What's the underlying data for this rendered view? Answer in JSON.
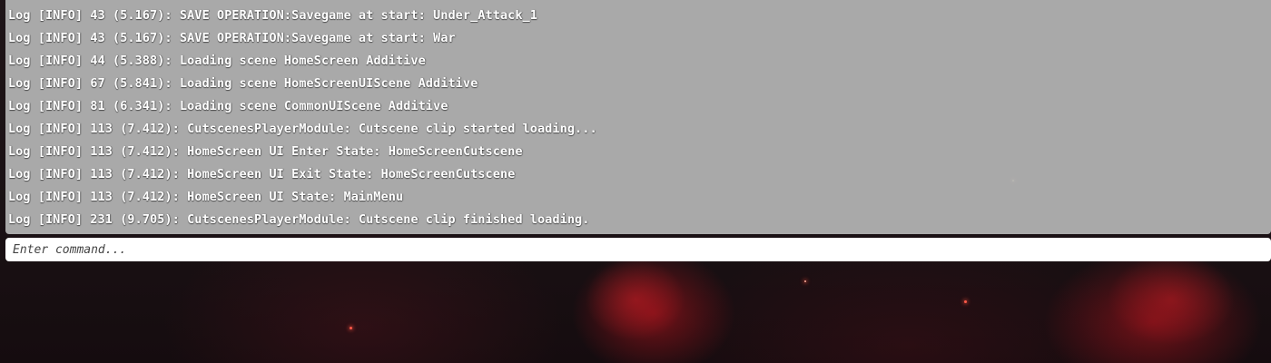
{
  "console": {
    "lines": [
      {
        "prefix": "Log",
        "level": "[INFO]",
        "frame": "43",
        "time": "(5.167):",
        "message": "SAVE OPERATION:Savegame at start: Under_Attack_1"
      },
      {
        "prefix": "Log",
        "level": "[INFO]",
        "frame": "43",
        "time": "(5.167):",
        "message": "SAVE OPERATION:Savegame at start: War"
      },
      {
        "prefix": "Log",
        "level": "[INFO]",
        "frame": "44",
        "time": "(5.388):",
        "message": "Loading scene HomeScreen Additive"
      },
      {
        "prefix": "Log",
        "level": "[INFO]",
        "frame": "67",
        "time": "(5.841):",
        "message": "Loading scene HomeScreenUIScene Additive"
      },
      {
        "prefix": "Log",
        "level": "[INFO]",
        "frame": "81",
        "time": "(6.341):",
        "message": "Loading scene CommonUIScene Additive"
      },
      {
        "prefix": "Log",
        "level": "[INFO]",
        "frame": "113",
        "time": "(7.412):",
        "message": "CutscenesPlayerModule: Cutscene clip started loading..."
      },
      {
        "prefix": "Log",
        "level": "[INFO]",
        "frame": "113",
        "time": "(7.412):",
        "message": "HomeScreen UI Enter State: HomeScreenCutscene"
      },
      {
        "prefix": "Log",
        "level": "[INFO]",
        "frame": "113",
        "time": "(7.412):",
        "message": "HomeScreen UI Exit State: HomeScreenCutscene"
      },
      {
        "prefix": "Log",
        "level": "[INFO]",
        "frame": "113",
        "time": "(7.412):",
        "message": "HomeScreen UI State: MainMenu"
      },
      {
        "prefix": "Log",
        "level": "[INFO]",
        "frame": "231",
        "time": "(9.705):",
        "message": "CutscenesPlayerModule: Cutscene clip finished loading."
      }
    ]
  },
  "command": {
    "placeholder": "Enter command...",
    "value": ""
  },
  "colors": {
    "panel_background": "#b2b2b2",
    "log_text": "#ffffff",
    "input_background": "#ffffff",
    "nebula_accent": "#c8141e"
  }
}
